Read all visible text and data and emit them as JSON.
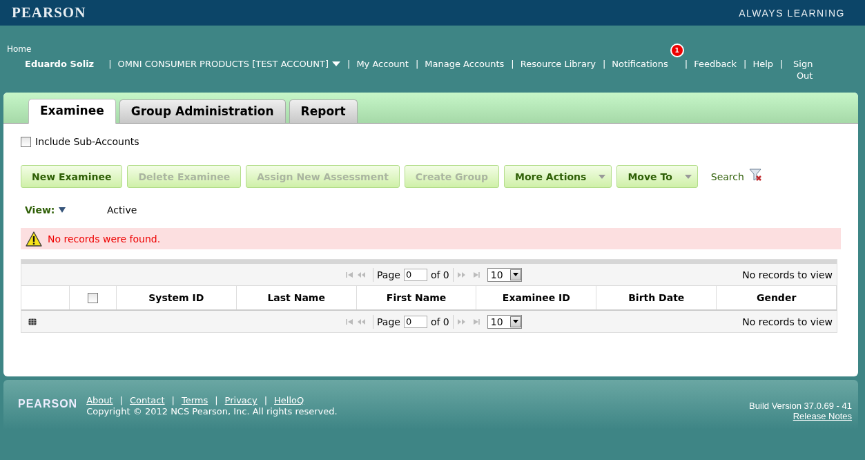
{
  "header": {
    "logo": "PEARSON",
    "tagline": "ALWAYS LEARNING"
  },
  "breadcrumb": "Home",
  "nav": [
    {
      "kind": "user",
      "label": "Eduardo Soliz"
    },
    {
      "kind": "separator",
      "label": "|"
    },
    {
      "kind": "dropdown",
      "label": "OMNI CONSUMER PRODUCTS [TEST ACCOUNT]"
    },
    {
      "kind": "separator",
      "label": "|"
    },
    {
      "kind": "link",
      "label": "My Account"
    },
    {
      "kind": "separator",
      "label": "|"
    },
    {
      "kind": "link",
      "label": "Manage Accounts"
    },
    {
      "kind": "separator",
      "label": "|"
    },
    {
      "kind": "link",
      "label": "Resource Library"
    },
    {
      "kind": "separator",
      "label": "|"
    },
    {
      "kind": "link",
      "label": "Notifications",
      "badge": "1"
    },
    {
      "kind": "separator",
      "label": "|"
    },
    {
      "kind": "link",
      "label": "Feedback"
    },
    {
      "kind": "separator",
      "label": "|"
    },
    {
      "kind": "link",
      "label": "Help"
    },
    {
      "kind": "separator",
      "label": "|"
    },
    {
      "kind": "link",
      "label": "Sign Out"
    }
  ],
  "tabs": [
    {
      "label": "Examinee",
      "selected": true
    },
    {
      "label": "Group Administration",
      "selected": false
    },
    {
      "label": "Report",
      "selected": false
    }
  ],
  "include_sub_accounts": {
    "label": "Include Sub-Accounts",
    "checked": false
  },
  "actions": [
    {
      "kind": "button",
      "label": "New Examinee",
      "disabled": false
    },
    {
      "kind": "button",
      "label": "Delete Examinee",
      "disabled": true
    },
    {
      "kind": "button",
      "label": "Assign New Assessment",
      "disabled": true
    },
    {
      "kind": "button",
      "label": "Create Group",
      "disabled": true
    },
    {
      "kind": "dropdown",
      "label": "More Actions",
      "disabled": false
    },
    {
      "kind": "dropdown",
      "label": "Move To",
      "disabled": false
    }
  ],
  "search": {
    "label": "Search"
  },
  "view": {
    "label": "View:",
    "value": "Active"
  },
  "alert": {
    "message": "No records were found."
  },
  "table": {
    "columns": [
      "",
      "",
      "System ID",
      "Last Name",
      "First Name",
      "Examinee ID",
      "Birth Date",
      "Gender"
    ],
    "select_all_checked": false,
    "pagers": [
      {
        "page_label": "Page",
        "page": "0",
        "of": "of 0",
        "page_size": "10",
        "status": "No records to view"
      },
      {
        "page_label": "Page",
        "page": "0",
        "of": "of 0",
        "page_size": "10",
        "status": "No records to view"
      }
    ]
  },
  "footer": {
    "logo": "PEARSON",
    "links": [
      {
        "kind": "link",
        "label": "About"
      },
      {
        "kind": "separator",
        "label": "|"
      },
      {
        "kind": "link",
        "label": "Contact"
      },
      {
        "kind": "separator",
        "label": "|"
      },
      {
        "kind": "link",
        "label": "Terms"
      },
      {
        "kind": "separator",
        "label": "|"
      },
      {
        "kind": "link",
        "label": "Privacy"
      },
      {
        "kind": "separator",
        "label": "|"
      },
      {
        "kind": "link",
        "label": "HelloQ"
      }
    ],
    "copyright": "Copyright © 2012 NCS Pearson, Inc. All rights reserved.",
    "build": "Build Version 37.0.69 - 41",
    "release_notes": "Release Notes"
  }
}
